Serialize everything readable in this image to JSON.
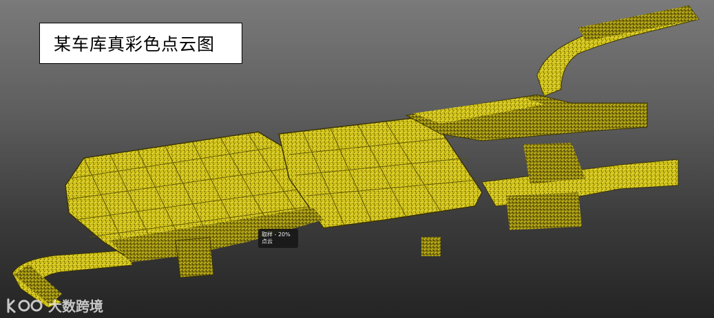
{
  "title": "某车库真彩色点云图",
  "tooltip": {
    "line1": "取样 - 20%",
    "line2": "点云"
  },
  "watermark": {
    "brand": "大数跨境"
  },
  "colors": {
    "background_top": "#7a7a7a",
    "background_bottom": "#242424",
    "point_cloud": "#d8c81c",
    "point_cloud_dark": "#2a2406"
  },
  "icons": [
    "point-cloud-garage-model",
    "watermark-logo-icon"
  ]
}
